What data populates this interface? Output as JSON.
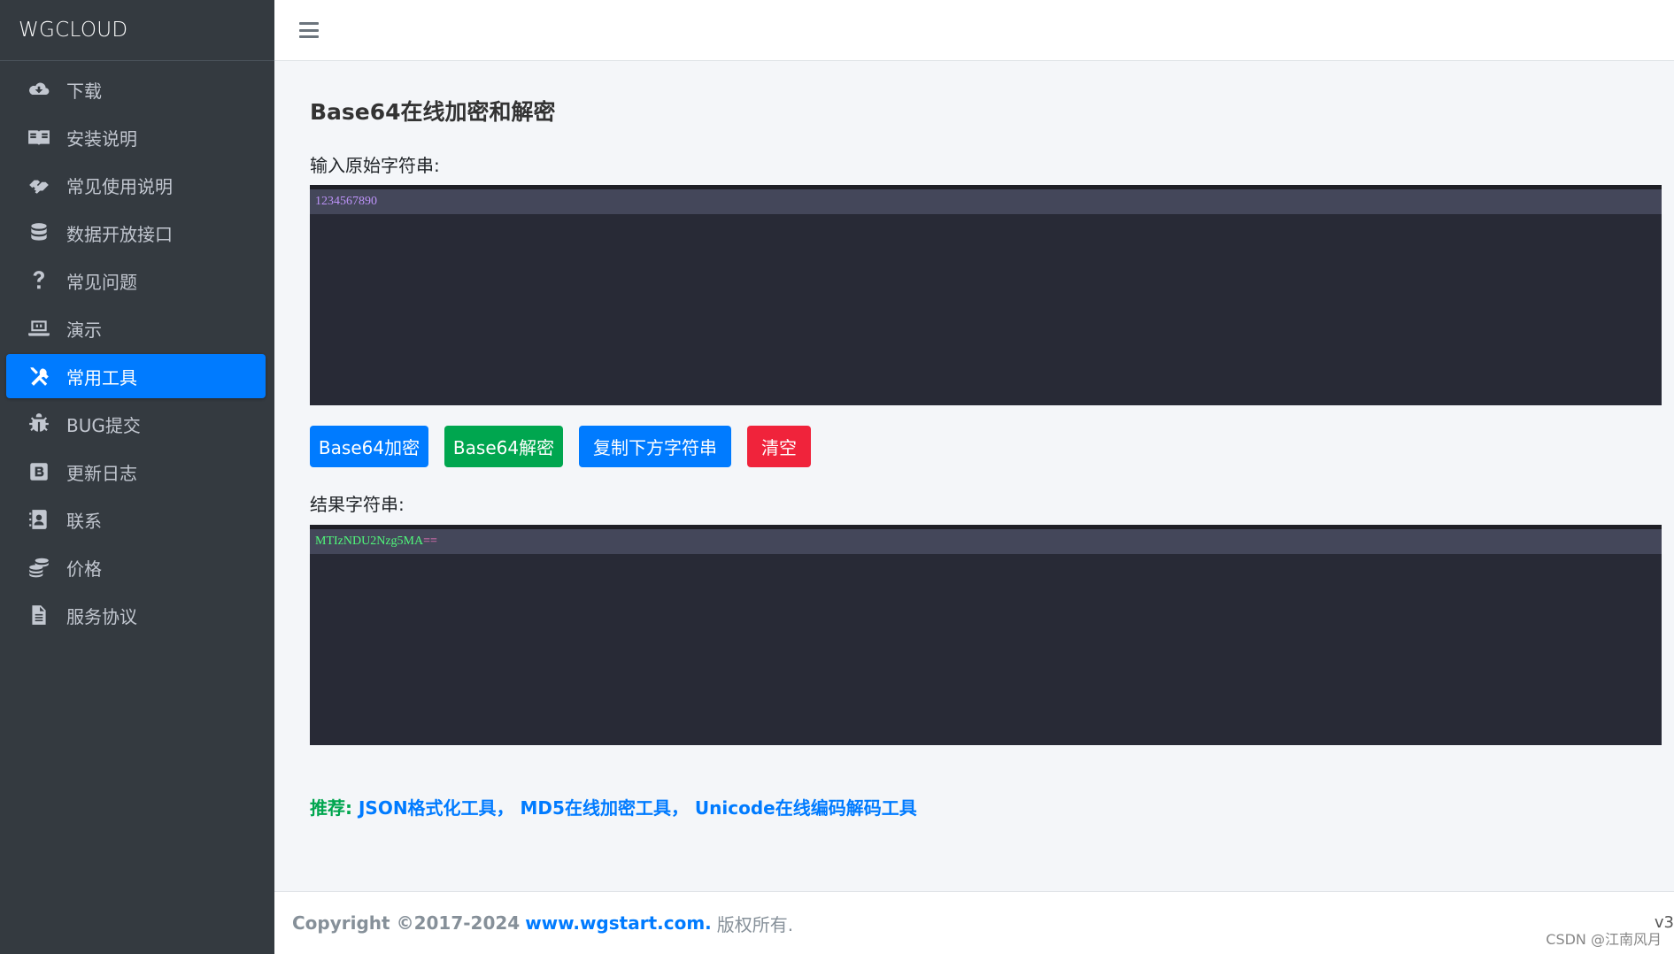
{
  "brand": {
    "title": "WGCLOUD"
  },
  "sidebar": {
    "items": [
      {
        "label": "下载",
        "icon": "cloud-download-icon"
      },
      {
        "label": "安装说明",
        "icon": "book-icon"
      },
      {
        "label": "常见使用说明",
        "icon": "handshake-icon"
      },
      {
        "label": "数据开放接口",
        "icon": "database-icon"
      },
      {
        "label": "常见问题",
        "icon": "question-icon"
      },
      {
        "label": "演示",
        "icon": "laptop-icon"
      },
      {
        "label": "常用工具",
        "icon": "tools-icon",
        "active": true
      },
      {
        "label": "BUG提交",
        "icon": "bug-icon"
      },
      {
        "label": "更新日志",
        "icon": "blog-icon"
      },
      {
        "label": "联系",
        "icon": "contact-icon"
      },
      {
        "label": "价格",
        "icon": "coins-icon"
      },
      {
        "label": "服务协议",
        "icon": "file-icon"
      }
    ]
  },
  "main": {
    "title": "Base64在线加密和解密",
    "input_label": "输入原始字符串:",
    "input_value": "1234567890",
    "buttons": {
      "encode": "Base64加密",
      "decode": "Base64解密",
      "copy": "复制下方字符串",
      "clear": "清空"
    },
    "result_label": "结果字符串:",
    "result_value_main": "MTIzNDU2Nzg5MA",
    "result_value_pad": "==",
    "recommend": {
      "lead": "推荐:",
      "links": [
        "JSON格式化工具",
        "MD5在线加密工具",
        "Unicode在线编码解码工具"
      ],
      "separator": "，"
    }
  },
  "footer": {
    "copyright": "Copyright ©2017-2024",
    "site": "www.wgstart.com.",
    "rights": "版权所有.",
    "version": "v3"
  },
  "watermark": "CSDN @江南风月",
  "colors": {
    "sidebar_bg": "#343a40",
    "accent": "#007bff",
    "green": "#00a64f",
    "red": "#f0233b",
    "editor_bg": "#282a36"
  }
}
